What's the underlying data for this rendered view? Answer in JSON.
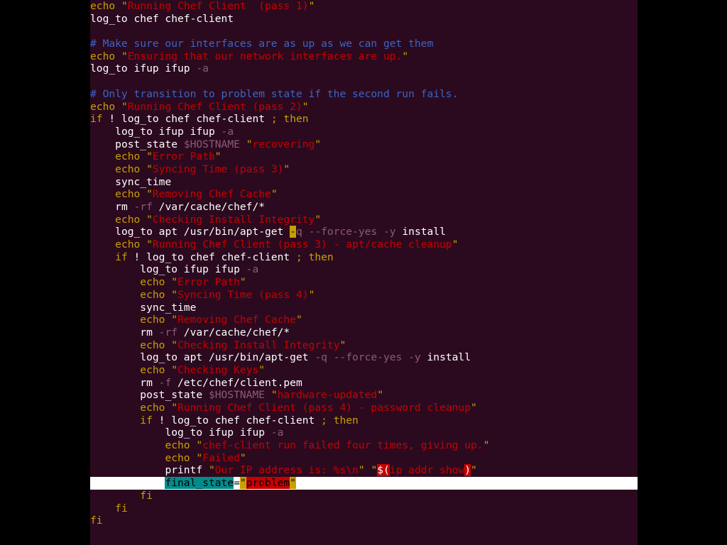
{
  "colors": {
    "background": "#2b0a1f",
    "plain": "#ffffff",
    "keyword": "#c8a000",
    "string": "#c80000",
    "comment": "#3c64c8",
    "flag": "#8c5a78",
    "variable": "#8c5a78",
    "cursor_line": "#ffffff",
    "match_highlight": "#008c8c",
    "paren_highlight": "#c80000",
    "paren_text": "#ffffff",
    "cursor_block": "#c8a000"
  },
  "lines": [
    {
      "indent": 0,
      "tokens": [
        {
          "t": "echo",
          "c": "keyword"
        },
        {
          "t": " ",
          "c": "plain"
        },
        {
          "t": "\"",
          "c": "keyword"
        },
        {
          "t": "Running Chef Client  (pass 1)",
          "c": "string"
        },
        {
          "t": "\"",
          "c": "keyword"
        }
      ]
    },
    {
      "indent": 0,
      "tokens": [
        {
          "t": "log_to chef chef-client",
          "c": "plain"
        }
      ]
    },
    {
      "indent": 0,
      "tokens": []
    },
    {
      "indent": 0,
      "tokens": [
        {
          "t": "# Make sure our interfaces are as up as we can get them",
          "c": "comment"
        }
      ]
    },
    {
      "indent": 0,
      "tokens": [
        {
          "t": "echo",
          "c": "keyword"
        },
        {
          "t": " ",
          "c": "plain"
        },
        {
          "t": "\"",
          "c": "keyword"
        },
        {
          "t": "Ensuring that our network interfaces are up.",
          "c": "string"
        },
        {
          "t": "\"",
          "c": "keyword"
        }
      ]
    },
    {
      "indent": 0,
      "tokens": [
        {
          "t": "log_to ifup ifup ",
          "c": "plain"
        },
        {
          "t": "-a",
          "c": "flag"
        }
      ]
    },
    {
      "indent": 0,
      "tokens": []
    },
    {
      "indent": 0,
      "tokens": [
        {
          "t": "# Only transition to problem state if the second run fails.",
          "c": "comment"
        }
      ]
    },
    {
      "indent": 0,
      "tokens": [
        {
          "t": "echo",
          "c": "keyword"
        },
        {
          "t": " ",
          "c": "plain"
        },
        {
          "t": "\"",
          "c": "keyword"
        },
        {
          "t": "Running Chef Client (pass 2)",
          "c": "string"
        },
        {
          "t": "\"",
          "c": "keyword"
        }
      ]
    },
    {
      "indent": 0,
      "tokens": [
        {
          "t": "if",
          "c": "keyword"
        },
        {
          "t": " ! log_to chef chef-client ",
          "c": "plain"
        },
        {
          "t": ";",
          "c": "keyword"
        },
        {
          "t": " ",
          "c": "plain"
        },
        {
          "t": "then",
          "c": "keyword"
        }
      ]
    },
    {
      "indent": 1,
      "tokens": [
        {
          "t": "log_to ifup ifup ",
          "c": "plain"
        },
        {
          "t": "-a",
          "c": "flag"
        }
      ]
    },
    {
      "indent": 1,
      "tokens": [
        {
          "t": "post_state ",
          "c": "plain"
        },
        {
          "t": "$HOSTNAME",
          "c": "variable"
        },
        {
          "t": " ",
          "c": "plain"
        },
        {
          "t": "\"",
          "c": "keyword"
        },
        {
          "t": "recovering",
          "c": "string"
        },
        {
          "t": "\"",
          "c": "keyword"
        }
      ]
    },
    {
      "indent": 1,
      "tokens": [
        {
          "t": "echo",
          "c": "keyword"
        },
        {
          "t": " ",
          "c": "plain"
        },
        {
          "t": "\"",
          "c": "keyword"
        },
        {
          "t": "Error Path",
          "c": "string"
        },
        {
          "t": "\"",
          "c": "keyword"
        }
      ]
    },
    {
      "indent": 1,
      "tokens": [
        {
          "t": "echo",
          "c": "keyword"
        },
        {
          "t": " ",
          "c": "plain"
        },
        {
          "t": "\"",
          "c": "keyword"
        },
        {
          "t": "Syncing Time (pass 3)",
          "c": "string"
        },
        {
          "t": "\"",
          "c": "keyword"
        }
      ]
    },
    {
      "indent": 1,
      "tokens": [
        {
          "t": "sync_time",
          "c": "plain"
        }
      ]
    },
    {
      "indent": 1,
      "tokens": [
        {
          "t": "echo",
          "c": "keyword"
        },
        {
          "t": " ",
          "c": "plain"
        },
        {
          "t": "\"",
          "c": "keyword"
        },
        {
          "t": "Removing Chef Cache",
          "c": "string"
        },
        {
          "t": "\"",
          "c": "keyword"
        }
      ]
    },
    {
      "indent": 1,
      "tokens": [
        {
          "t": "rm ",
          "c": "plain"
        },
        {
          "t": "-rf",
          "c": "flag"
        },
        {
          "t": " /var/cache/chef/*",
          "c": "plain"
        }
      ]
    },
    {
      "indent": 1,
      "tokens": [
        {
          "t": "echo",
          "c": "keyword"
        },
        {
          "t": " ",
          "c": "plain"
        },
        {
          "t": "\"",
          "c": "keyword"
        },
        {
          "t": "Checking Install Integrity",
          "c": "string"
        },
        {
          "t": "\"",
          "c": "keyword"
        }
      ]
    },
    {
      "indent": 1,
      "tokens": [
        {
          "t": "log_to apt /usr/bin/apt-get ",
          "c": "plain"
        },
        {
          "t": "-",
          "c": "cursor"
        },
        {
          "t": "q",
          "c": "flag"
        },
        {
          "t": " ",
          "c": "plain"
        },
        {
          "t": "--force-yes",
          "c": "flag"
        },
        {
          "t": " ",
          "c": "plain"
        },
        {
          "t": "-y",
          "c": "flag"
        },
        {
          "t": " install",
          "c": "plain"
        }
      ]
    },
    {
      "indent": 1,
      "tokens": [
        {
          "t": "echo",
          "c": "keyword"
        },
        {
          "t": " ",
          "c": "plain"
        },
        {
          "t": "\"",
          "c": "keyword"
        },
        {
          "t": "Running Chef Client (pass 3) - apt/cache cleanup",
          "c": "string"
        },
        {
          "t": "\"",
          "c": "keyword"
        }
      ]
    },
    {
      "indent": 1,
      "tokens": [
        {
          "t": "if",
          "c": "keyword"
        },
        {
          "t": " ! log_to chef chef-client ",
          "c": "plain"
        },
        {
          "t": ";",
          "c": "keyword"
        },
        {
          "t": " ",
          "c": "plain"
        },
        {
          "t": "then",
          "c": "keyword"
        }
      ]
    },
    {
      "indent": 2,
      "tokens": [
        {
          "t": "log_to ifup ifup ",
          "c": "plain"
        },
        {
          "t": "-a",
          "c": "flag"
        }
      ]
    },
    {
      "indent": 2,
      "tokens": [
        {
          "t": "echo",
          "c": "keyword"
        },
        {
          "t": " ",
          "c": "plain"
        },
        {
          "t": "\"",
          "c": "keyword"
        },
        {
          "t": "Error Path",
          "c": "string"
        },
        {
          "t": "\"",
          "c": "keyword"
        }
      ]
    },
    {
      "indent": 2,
      "tokens": [
        {
          "t": "echo",
          "c": "keyword"
        },
        {
          "t": " ",
          "c": "plain"
        },
        {
          "t": "\"",
          "c": "keyword"
        },
        {
          "t": "Syncing Time (pass 4)",
          "c": "string"
        },
        {
          "t": "\"",
          "c": "keyword"
        }
      ]
    },
    {
      "indent": 2,
      "tokens": [
        {
          "t": "sync_time",
          "c": "plain"
        }
      ]
    },
    {
      "indent": 2,
      "tokens": [
        {
          "t": "echo",
          "c": "keyword"
        },
        {
          "t": " ",
          "c": "plain"
        },
        {
          "t": "\"",
          "c": "keyword"
        },
        {
          "t": "Removing Chef Cache",
          "c": "string"
        },
        {
          "t": "\"",
          "c": "keyword"
        }
      ]
    },
    {
      "indent": 2,
      "tokens": [
        {
          "t": "rm ",
          "c": "plain"
        },
        {
          "t": "-rf",
          "c": "flag"
        },
        {
          "t": " /var/cache/chef/*",
          "c": "plain"
        }
      ]
    },
    {
      "indent": 2,
      "tokens": [
        {
          "t": "echo",
          "c": "keyword"
        },
        {
          "t": " ",
          "c": "plain"
        },
        {
          "t": "\"",
          "c": "keyword"
        },
        {
          "t": "Checking Install Integrity",
          "c": "string"
        },
        {
          "t": "\"",
          "c": "keyword"
        }
      ]
    },
    {
      "indent": 2,
      "tokens": [
        {
          "t": "log_to apt /usr/bin/apt-get ",
          "c": "plain"
        },
        {
          "t": "-q",
          "c": "flag"
        },
        {
          "t": " ",
          "c": "plain"
        },
        {
          "t": "--force-yes",
          "c": "flag"
        },
        {
          "t": " ",
          "c": "plain"
        },
        {
          "t": "-y",
          "c": "flag"
        },
        {
          "t": " install",
          "c": "plain"
        }
      ]
    },
    {
      "indent": 2,
      "tokens": [
        {
          "t": "echo",
          "c": "keyword"
        },
        {
          "t": " ",
          "c": "plain"
        },
        {
          "t": "\"",
          "c": "keyword"
        },
        {
          "t": "Checking Keys",
          "c": "string"
        },
        {
          "t": "\"",
          "c": "keyword"
        }
      ]
    },
    {
      "indent": 2,
      "tokens": [
        {
          "t": "rm ",
          "c": "plain"
        },
        {
          "t": "-f",
          "c": "flag"
        },
        {
          "t": " /etc/chef/client.pem",
          "c": "plain"
        }
      ]
    },
    {
      "indent": 2,
      "tokens": [
        {
          "t": "post_state ",
          "c": "plain"
        },
        {
          "t": "$HOSTNAME",
          "c": "variable"
        },
        {
          "t": " ",
          "c": "plain"
        },
        {
          "t": "\"",
          "c": "keyword"
        },
        {
          "t": "hardware-updated",
          "c": "string"
        },
        {
          "t": "\"",
          "c": "keyword"
        }
      ]
    },
    {
      "indent": 2,
      "tokens": [
        {
          "t": "echo",
          "c": "keyword"
        },
        {
          "t": " ",
          "c": "plain"
        },
        {
          "t": "\"",
          "c": "keyword"
        },
        {
          "t": "Running Chef Client (pass 4) - password cleanup",
          "c": "string"
        },
        {
          "t": "\"",
          "c": "keyword"
        }
      ]
    },
    {
      "indent": 2,
      "tokens": [
        {
          "t": "if",
          "c": "keyword"
        },
        {
          "t": " ! log_to chef chef-client ",
          "c": "plain"
        },
        {
          "t": ";",
          "c": "keyword"
        },
        {
          "t": " ",
          "c": "plain"
        },
        {
          "t": "then",
          "c": "keyword"
        }
      ]
    },
    {
      "indent": 3,
      "tokens": [
        {
          "t": "log_to ifup ifup ",
          "c": "plain"
        },
        {
          "t": "-a",
          "c": "flag"
        }
      ]
    },
    {
      "indent": 3,
      "tokens": [
        {
          "t": "echo",
          "c": "keyword"
        },
        {
          "t": " ",
          "c": "plain"
        },
        {
          "t": "\"",
          "c": "keyword"
        },
        {
          "t": "chef-client run failed four times, giving up.",
          "c": "string"
        },
        {
          "t": "\"",
          "c": "keyword"
        }
      ]
    },
    {
      "indent": 3,
      "tokens": [
        {
          "t": "echo",
          "c": "keyword"
        },
        {
          "t": " ",
          "c": "plain"
        },
        {
          "t": "\"",
          "c": "keyword"
        },
        {
          "t": "Failed",
          "c": "string"
        },
        {
          "t": "\"",
          "c": "keyword"
        }
      ]
    },
    {
      "indent": 3,
      "tokens": [
        {
          "t": "printf ",
          "c": "plain"
        },
        {
          "t": "\"",
          "c": "keyword"
        },
        {
          "t": "Our IP address is: %s\\n",
          "c": "string"
        },
        {
          "t": "\"",
          "c": "keyword"
        },
        {
          "t": " ",
          "c": "plain"
        },
        {
          "t": "\"",
          "c": "keyword"
        },
        {
          "t": "$(",
          "c": "paren"
        },
        {
          "t": "ip addr show",
          "c": "string"
        },
        {
          "t": ")",
          "c": "paren"
        },
        {
          "t": "\"",
          "c": "keyword"
        }
      ]
    },
    {
      "indent": 3,
      "cursorline": true,
      "tokens": [
        {
          "t": "final_state",
          "c": "match"
        },
        {
          "t": "=",
          "c": "cursorplain"
        },
        {
          "t": "\"",
          "c": "cursorquote"
        },
        {
          "t": "problem",
          "c": "cursorstring"
        },
        {
          "t": "\"",
          "c": "cursorquote"
        }
      ]
    },
    {
      "indent": 2,
      "tokens": [
        {
          "t": "fi",
          "c": "keyword"
        }
      ]
    },
    {
      "indent": 1,
      "tokens": [
        {
          "t": "fi",
          "c": "keyword"
        }
      ]
    },
    {
      "indent": 0,
      "tokens": [
        {
          "t": "fi",
          "c": "keyword"
        }
      ]
    }
  ]
}
